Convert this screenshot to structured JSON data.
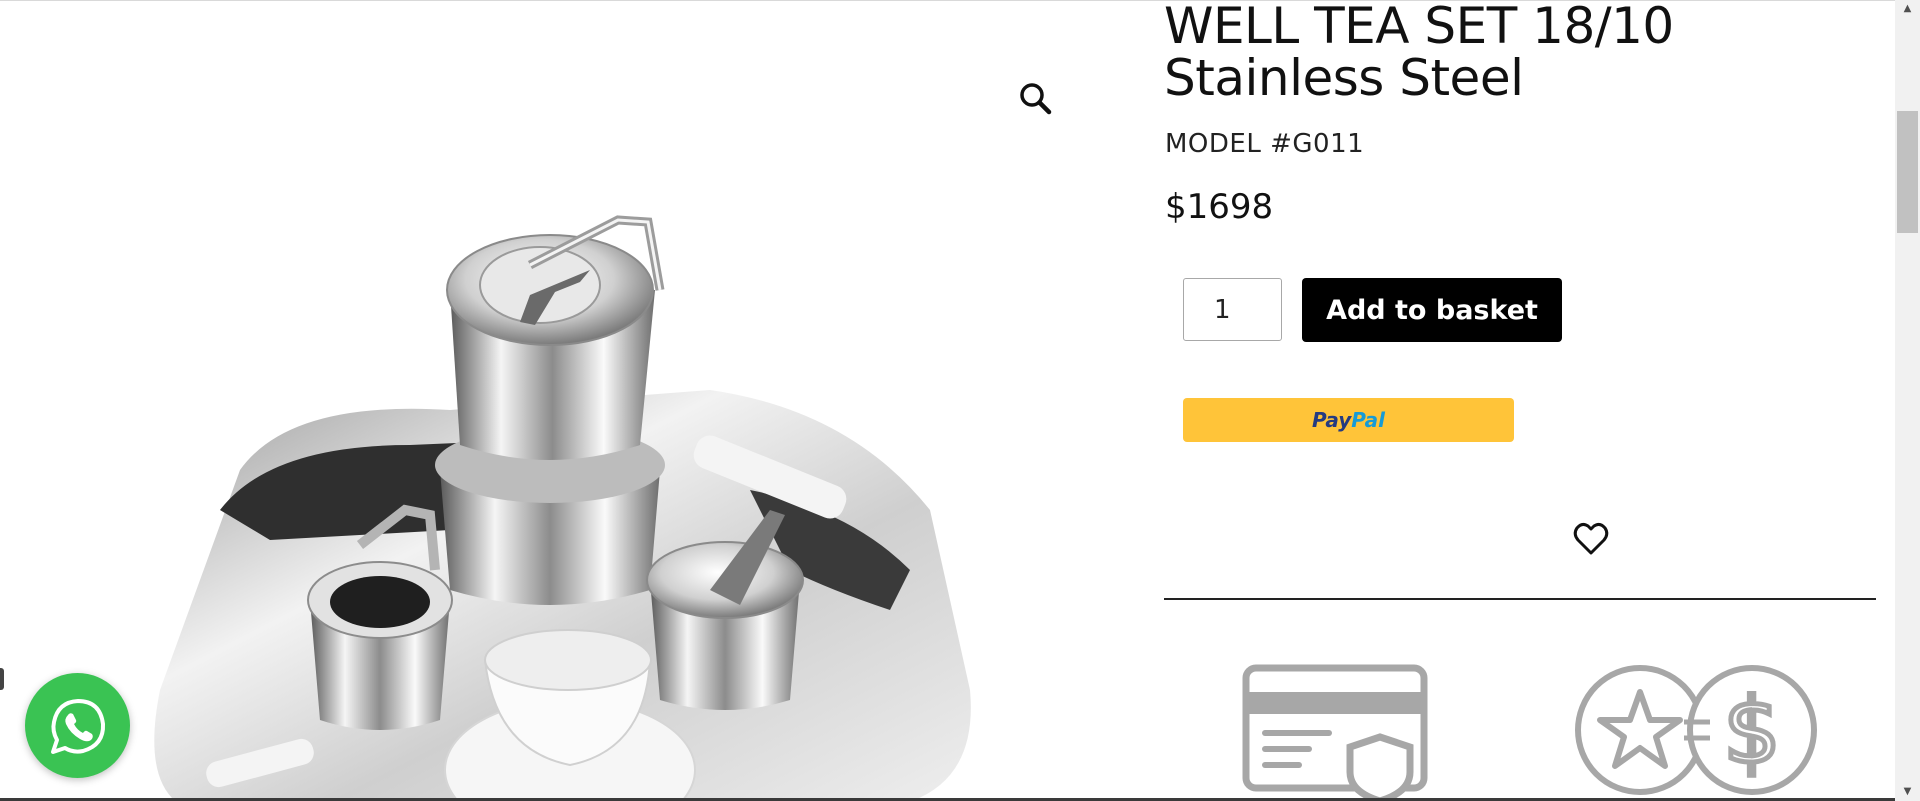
{
  "product": {
    "title": "WELL TEA SET 18/10 Stainless Steel",
    "model": "MODEL #G011",
    "price": "$1698",
    "quantity": "1",
    "add_to_basket_label": "Add to basket"
  },
  "paypal": {
    "brand_a": "Pay",
    "brand_b": "Pal"
  },
  "icons": {
    "zoom": "magnifier-icon",
    "wishlist": "heart-icon",
    "secure_payment": "credit-card-shield-icon",
    "points_exchange": "star-dollar-exchange-icon",
    "chat": "whatsapp-icon"
  },
  "colors": {
    "add_button_bg": "#000000",
    "paypal_bg": "#ffc439",
    "paypal_dark": "#253b80",
    "paypal_light": "#179bd7",
    "whatsapp_bg": "#3ac353",
    "feature_icon": "#a7a7a7"
  },
  "scrollbar": {
    "up_glyph": "▲",
    "down_glyph": "▼"
  }
}
